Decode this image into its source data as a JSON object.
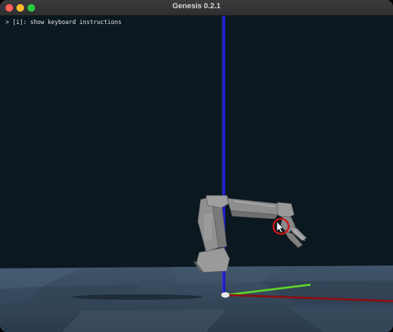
{
  "window": {
    "title": "Genesis 0.2.1",
    "controls": [
      "close",
      "minimize",
      "maximize"
    ]
  },
  "viewport": {
    "overlay_text": "> [i]: show keyboard instructions",
    "colors": {
      "background": "#0b1820",
      "floor": "#3d5062",
      "axis_x": "#8a1010",
      "axis_y": "#5fd12c",
      "axis_z": "#1c1cc8",
      "robot": "#8c8c8c",
      "cursor_highlight": "#d21414"
    }
  }
}
